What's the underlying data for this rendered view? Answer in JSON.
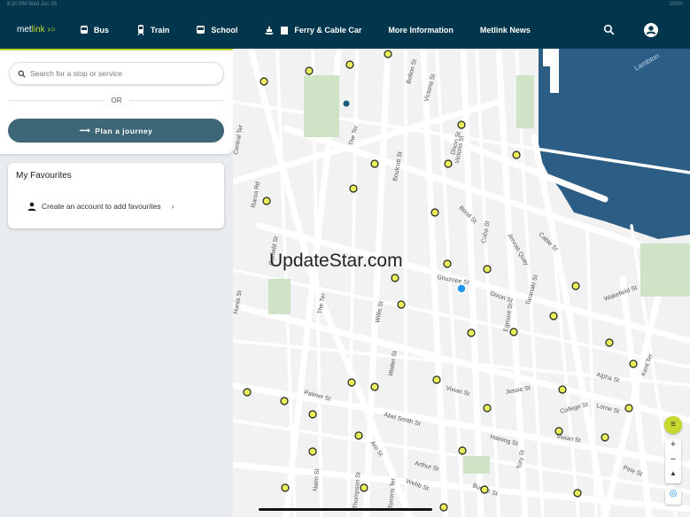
{
  "status": {
    "time": "9:20 PM  Wed Jun 28",
    "battery": "100%"
  },
  "nav": {
    "logo_a": "met",
    "logo_b": "link",
    "items": [
      "Bus",
      "Train",
      "School",
      "Ferry & Cable Car",
      "More Information",
      "Metlink News"
    ]
  },
  "search": {
    "placeholder": "Search for a stop or service"
  },
  "or_label": "OR",
  "plan_label": "Plan a journey",
  "favourites": {
    "title": "My Favourites",
    "create_label": "Create an account to add favourites"
  },
  "map": {
    "sea_label": "Lambton",
    "streets": [
      "The Ter",
      "Boulcott St",
      "Willis St",
      "Victoria St",
      "Cuba St",
      "Dixon St",
      "Cable St",
      "Wakefield St",
      "Taranaki St",
      "Jervois Quay",
      "Vivian St",
      "Abel Smith St",
      "Ghuznee St",
      "Jessie St",
      "College St",
      "Vivian St",
      "Haining St",
      "Arthur St",
      "Webb St",
      "Buckle St",
      "Tory St",
      "Pirie St",
      "Kent Ter",
      "Alpha St",
      "Lorne St",
      "Palmer St",
      "Aro St",
      "Nairn St",
      "Torrens Ter",
      "Bolton St",
      "Central Ter",
      "Raroa Rd",
      "Garfield St",
      "Dixon St",
      "Bond St",
      "Egmont St",
      "Walter St",
      "Thompson St",
      "Hania St",
      "Victoria St",
      "The Ter"
    ],
    "watermark": "UpdateStar.com",
    "zoom_in": "+",
    "zoom_out": "−"
  }
}
